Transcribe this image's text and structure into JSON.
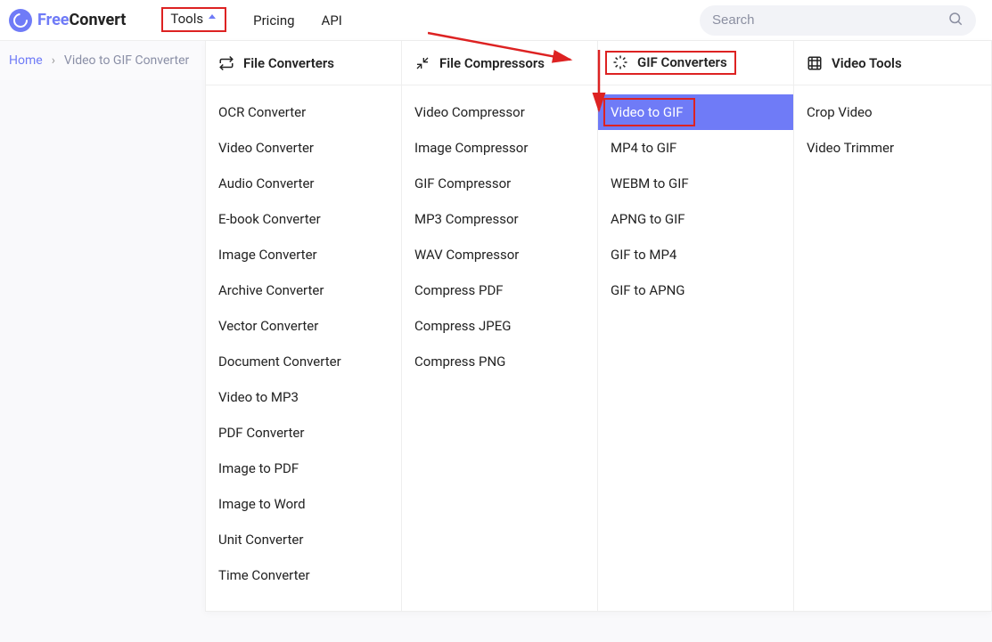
{
  "brand": {
    "free": "Free",
    "convert": "Convert"
  },
  "nav": {
    "tools": "Tools",
    "pricing": "Pricing",
    "api": "API"
  },
  "search": {
    "placeholder": "Search"
  },
  "crumbs": {
    "home": "Home",
    "current": "Video to GIF Converter"
  },
  "mega": {
    "cols": [
      {
        "head": "File Converters",
        "items": [
          "OCR Converter",
          "Video Converter",
          "Audio Converter",
          "E-book Converter",
          "Image Converter",
          "Archive Converter",
          "Vector Converter",
          "Document Converter",
          "Video to MP3",
          "PDF Converter",
          "Image to PDF",
          "Image to Word",
          "Unit Converter",
          "Time Converter"
        ]
      },
      {
        "head": "File Compressors",
        "items": [
          "Video Compressor",
          "Image Compressor",
          "GIF Compressor",
          "MP3 Compressor",
          "WAV Compressor",
          "Compress PDF",
          "Compress JPEG",
          "Compress PNG"
        ]
      },
      {
        "head": "GIF Converters",
        "items": [
          "Video to GIF",
          "MP4 to GIF",
          "WEBM to GIF",
          "APNG to GIF",
          "GIF to MP4",
          "GIF to APNG"
        ],
        "highlight_index": 0,
        "head_boxed": true
      },
      {
        "head": "Video Tools",
        "items": [
          "Crop Video",
          "Video Trimmer"
        ]
      }
    ]
  }
}
